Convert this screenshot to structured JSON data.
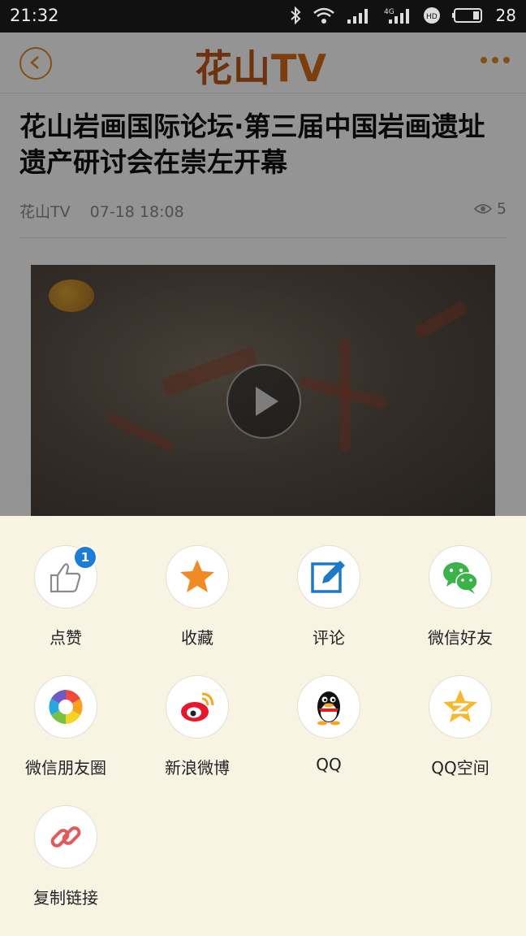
{
  "status_bar": {
    "time": "21:32",
    "battery": "28"
  },
  "header": {
    "logo_cn": "花山",
    "logo_tv": "TV"
  },
  "article": {
    "title": "花山岩画国际论坛·第三届中国岩画遗址遗产研讨会在崇左开幕",
    "source": "花山TV",
    "date": "07-18 18:08",
    "views": "5"
  },
  "share_sheet": {
    "items": [
      {
        "label": "点赞",
        "icon": "thumbs-up-icon",
        "badge": "1"
      },
      {
        "label": "收藏",
        "icon": "star-icon"
      },
      {
        "label": "评论",
        "icon": "edit-icon"
      },
      {
        "label": "微信好友",
        "icon": "wechat-icon"
      },
      {
        "label": "微信朋友圈",
        "icon": "moments-icon"
      },
      {
        "label": "新浪微博",
        "icon": "weibo-icon"
      },
      {
        "label": "QQ",
        "icon": "qq-icon"
      },
      {
        "label": "QQ空间",
        "icon": "qzone-icon"
      },
      {
        "label": "复制链接",
        "icon": "link-icon"
      }
    ]
  },
  "colors": {
    "accent": "#e08a1e",
    "sheet_bg": "#f8f4e4",
    "badge": "#1e7cd6"
  }
}
